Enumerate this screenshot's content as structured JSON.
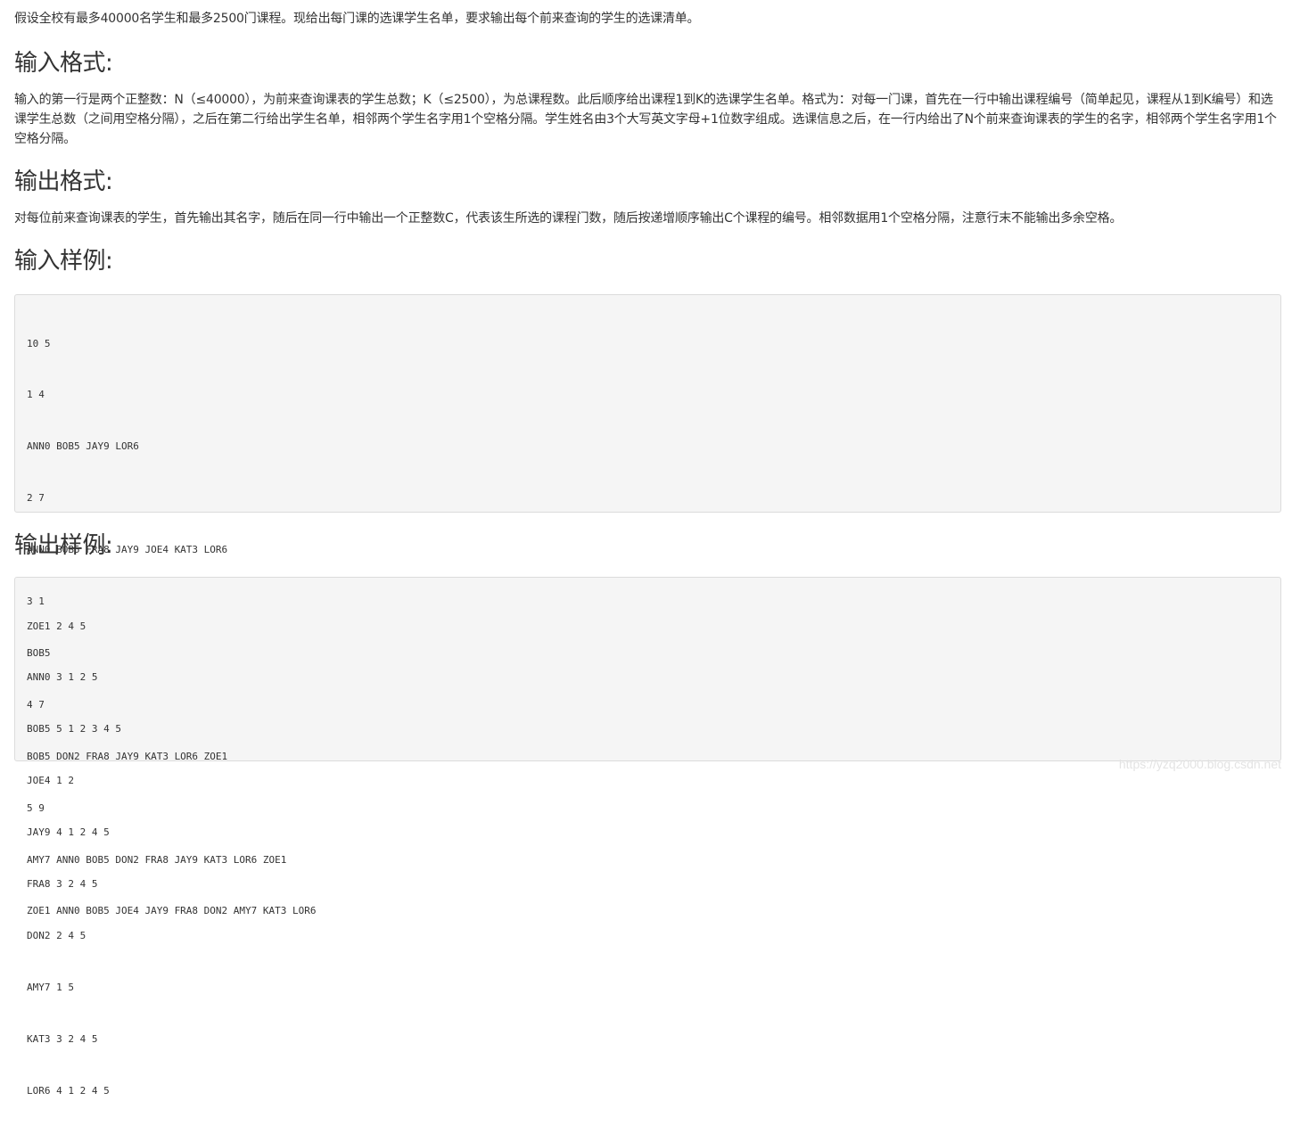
{
  "intro": "假设全校有最多40000名学生和最多2500门课程。现给出每门课的选课学生名单，要求输出每个前来查询的学生的选课清单。",
  "input_format": {
    "heading": "输入格式:",
    "text": "输入的第一行是两个正整数：N（≤40000），为前来查询课表的学生总数；K（≤2500），为总课程数。此后顺序给出课程1到K的选课学生名单。格式为：对每一门课，首先在一行中输出课程编号（简单起见，课程从1到K编号）和选课学生总数（之间用空格分隔），之后在第二行给出学生名单，相邻两个学生名字用1个空格分隔。学生姓名由3个大写英文字母+1位数字组成。选课信息之后，在一行内给出了N个前来查询课表的学生的名字，相邻两个学生名字用1个空格分隔。"
  },
  "output_format": {
    "heading": "输出格式:",
    "text": "对每位前来查询课表的学生，首先输出其名字，随后在同一行中输出一个正整数C，代表该生所选的课程门数，随后按递增顺序输出C个课程的编号。相邻数据用1个空格分隔，注意行末不能输出多余空格。"
  },
  "sample_input": {
    "heading": "输入样例:",
    "lines": [
      "10 5",
      "1 4",
      "ANN0 BOB5 JAY9 LOR6",
      "2 7",
      "ANN0 BOB5 FRA8 JAY9 JOE4 KAT3 LOR6",
      "3 1",
      "BOB5",
      "4 7",
      "BOB5 DON2 FRA8 JAY9 KAT3 LOR6 ZOE1",
      "5 9",
      "AMY7 ANN0 BOB5 DON2 FRA8 JAY9 KAT3 LOR6 ZOE1",
      "ZOE1 ANN0 BOB5 JOE4 JAY9 FRA8 DON2 AMY7 KAT3 LOR6"
    ]
  },
  "sample_output": {
    "heading": "输出样例:",
    "lines": [
      "ZOE1 2 4 5",
      "ANN0 3 1 2 5",
      "BOB5 5 1 2 3 4 5",
      "JOE4 1 2",
      "JAY9 4 1 2 4 5",
      "FRA8 3 2 4 5",
      "DON2 2 4 5",
      "AMY7 1 5",
      "KAT3 3 2 4 5",
      "LOR6 4 1 2 4 5"
    ]
  },
  "watermark": "https://yzq2000.blog.csdn.net"
}
